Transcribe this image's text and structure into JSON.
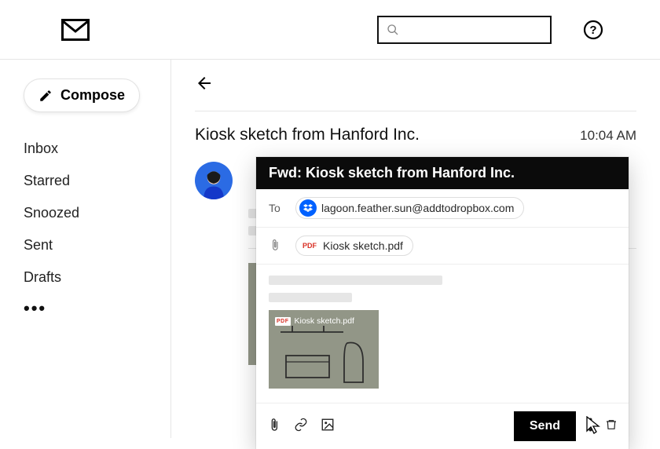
{
  "header": {
    "search_placeholder": ""
  },
  "sidebar": {
    "compose_label": "Compose",
    "items": [
      "Inbox",
      "Starred",
      "Snoozed",
      "Sent",
      "Drafts"
    ]
  },
  "thread": {
    "title": "Kiosk sketch from Hanford Inc.",
    "time": "10:04 AM",
    "attachment_name": "Kiosk sketch.pdf"
  },
  "composer": {
    "subject": "Fwd: Kiosk sketch from Hanford Inc.",
    "to_label": "To",
    "to_value": "lagoon.feather.sun@addtodropbox.com",
    "attachment_name": "Kiosk sketch.pdf",
    "body_attachment_name": "Kiosk sketch.pdf",
    "send_label": "Send"
  },
  "icons": {
    "pdf_label": "PDF"
  }
}
